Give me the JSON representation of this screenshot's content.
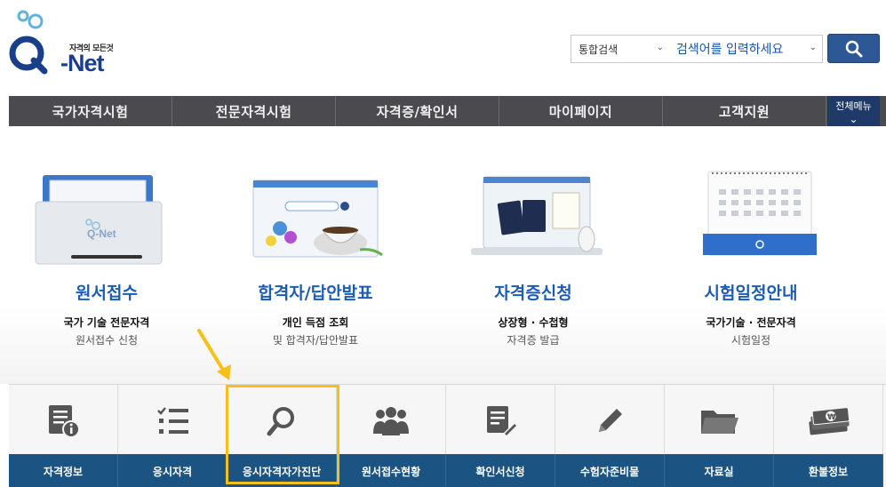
{
  "header": {
    "logo_tagline": "자격의 모든것",
    "logo_text": "-Net",
    "search": {
      "category": "통합검색",
      "placeholder": "검색어를 입력하세요"
    }
  },
  "nav": {
    "items": [
      "국가자격시험",
      "전문자격시험",
      "자격증/확인서",
      "마이페이지",
      "고객지원"
    ],
    "all_menu": "전체메뉴"
  },
  "cards": [
    {
      "title": "원서접수",
      "sub1": "국가 기술 전문자격",
      "sub2": "원서접수 신청"
    },
    {
      "title": "합격자/답안발표",
      "sub1": "개인 득점 조회",
      "sub2": "및 합격자/답안발표"
    },
    {
      "title": "자격증신청",
      "sub1": "상장형 · 수첩형",
      "sub2": "자격증 발급"
    },
    {
      "title": "시험일정안내",
      "sub1": "국가기술 · 전문자격",
      "sub2": "시험일정"
    }
  ],
  "quick_menu": [
    {
      "label": "자격정보",
      "icon": "info-document-icon"
    },
    {
      "label": "응시자격",
      "icon": "checklist-icon"
    },
    {
      "label": "응시자격자가진단",
      "icon": "magnifier-icon"
    },
    {
      "label": "원서접수현황",
      "icon": "people-group-icon"
    },
    {
      "label": "확인서신청",
      "icon": "document-edit-icon"
    },
    {
      "label": "수험자준비물",
      "icon": "pencil-icon"
    },
    {
      "label": "자료실",
      "icon": "folder-icon"
    },
    {
      "label": "환불정보",
      "icon": "money-icon"
    }
  ],
  "colors": {
    "nav_bg": "#4a4a4f",
    "accent_blue": "#1c5db3",
    "quick_label_bg": "#1b5382",
    "highlight": "#f7bf1a"
  }
}
